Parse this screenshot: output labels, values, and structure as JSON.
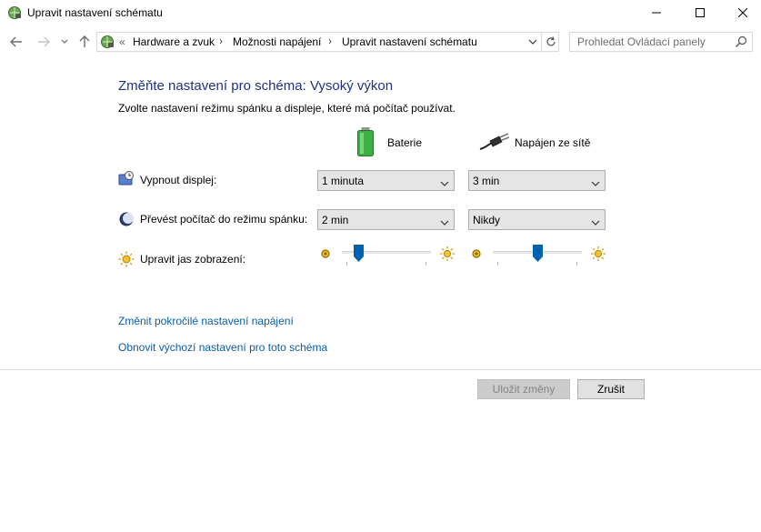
{
  "window": {
    "title": "Upravit nastavení schématu"
  },
  "nav": {
    "breadcrumb_prefix": "«",
    "breadcrumbs": [
      "Hardware a zvuk",
      "Možnosti napájení",
      "Upravit nastavení schématu"
    ],
    "search_placeholder": "Prohledat Ovládací panely"
  },
  "main": {
    "heading": "Změňte nastavení pro schéma: Vysoký výkon",
    "subheading": "Zvolte nastavení režimu spánku a displeje, které má počítač používat.",
    "columns": {
      "battery": "Baterie",
      "plugged_in": "Napájen ze sítě"
    },
    "rows": {
      "display": {
        "label": "Vypnout displej:",
        "battery_value": "1 minuta",
        "plugged_value": "3 min"
      },
      "sleep": {
        "label": "Převést počítač do režimu spánku:",
        "battery_value": "2 min",
        "plugged_value": "Nikdy"
      },
      "brightness": {
        "label": "Upravit jas zobrazení:",
        "battery_level": 0.15,
        "plugged_level": 0.5
      }
    },
    "links": {
      "advanced": "Změnit pokročilé nastavení napájení",
      "restore": "Obnovit výchozí nastavení pro toto schéma"
    }
  },
  "buttons": {
    "save": "Uložit změny",
    "cancel": "Zrušit"
  },
  "colors": {
    "heading": "#1e3287",
    "link": "#0b5ba8",
    "slider_thumb": "#0063b1"
  }
}
